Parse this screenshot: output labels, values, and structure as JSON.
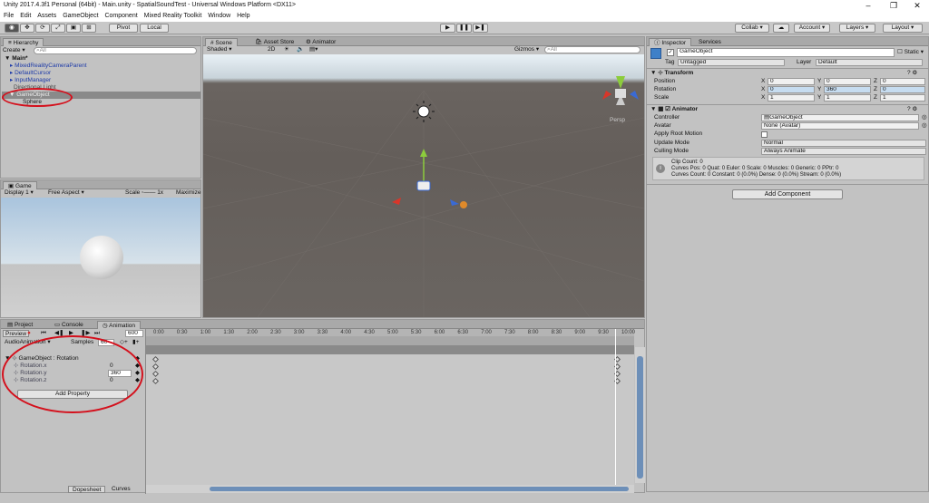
{
  "window": {
    "title": "Unity 2017.4.3f1 Personal (64bit) - Main.unity - SpatialSoundTest - Universal Windows Platform <DX11>"
  },
  "menu": [
    "File",
    "Edit",
    "Assets",
    "GameObject",
    "Component",
    "Mixed Reality Toolkit",
    "Window",
    "Help"
  ],
  "toolbar": {
    "pivot": "Pivot",
    "local": "Local",
    "collab": "Collab",
    "account": "Account",
    "layers": "Layers",
    "layout": "Layout"
  },
  "hierarchy": {
    "tab": "Hierarchy",
    "create": "Create",
    "search_placeholder": "All",
    "scene": "Main*",
    "items": [
      "MixedRealityCameraParent",
      "DefaultCursor",
      "InputManager",
      "GameObject",
      "Sphere"
    ],
    "hidden_item": "Directional Light"
  },
  "scene": {
    "tabs": [
      "Scene",
      "Asset Store",
      "Animator"
    ],
    "shading": "Shaded",
    "mode2d": "2D",
    "gizmos": "Gizmos",
    "search": "All",
    "persp": "Persp"
  },
  "game": {
    "tab": "Game",
    "display": "Display 1",
    "aspect": "Free Aspect",
    "scale_label": "Scale",
    "scale_value": "1x",
    "maximize": "Maximize"
  },
  "inspector": {
    "tabs": [
      "Inspector",
      "Services"
    ],
    "object_name": "GameObject",
    "static": "Static",
    "tag_label": "Tag",
    "tag": "Untagged",
    "layer_label": "Layer",
    "layer": "Default",
    "transform": {
      "title": "Transform",
      "rows": [
        {
          "label": "Position",
          "x": "0",
          "y": "0",
          "z": "0"
        },
        {
          "label": "Rotation",
          "x": "0",
          "y": "360",
          "z": "0"
        },
        {
          "label": "Scale",
          "x": "1",
          "y": "1",
          "z": "1"
        }
      ]
    },
    "animator": {
      "title": "Animator",
      "controller_label": "Controller",
      "controller": "GameObject",
      "avatar_label": "Avatar",
      "avatar": "None (Avatar)",
      "root_motion": "Apply Root Motion",
      "update_mode_label": "Update Mode",
      "update_mode": "Normal",
      "culling_label": "Culling Mode",
      "culling": "Always Animate",
      "info": [
        "Clip Count: 0",
        "Curves Pos: 0 Quat: 0 Euler: 0 Scale: 0 Muscles: 0 Generic: 0 PPtr: 0",
        "Curves Count: 0 Constant: 0 (0.0%) Dense: 0 (0.0%) Stream: 0 (0.0%)"
      ]
    },
    "add_component": "Add Component"
  },
  "animation": {
    "tabs": [
      "Project",
      "Console",
      "Animation"
    ],
    "preview": "Preview",
    "frame": "600",
    "clip": "AudioAnimation",
    "samples_label": "Samples",
    "samples": "60",
    "group": "GameObject : Rotation",
    "props": [
      {
        "name": "Rotation.x",
        "value": "0"
      },
      {
        "name": "Rotation.y",
        "value": "360"
      },
      {
        "name": "Rotation.z",
        "value": "0"
      }
    ],
    "add_property": "Add Property",
    "ticks": [
      "0:00",
      "0:30",
      "1:00",
      "1:30",
      "2:00",
      "2:30",
      "3:00",
      "3:30",
      "4:00",
      "4:30",
      "5:00",
      "5:30",
      "6:00",
      "6:30",
      "7:00",
      "7:30",
      "8:00",
      "8:30",
      "9:00",
      "9:30",
      "10:00"
    ],
    "dopesheet": "Dopesheet",
    "curves": "Curves"
  },
  "colors": {
    "accent_red": "#d4101c",
    "link_blue": "#1d3aa8",
    "record_red": "#d23030"
  }
}
